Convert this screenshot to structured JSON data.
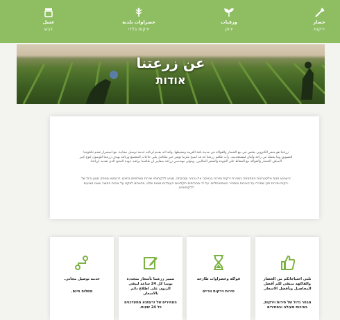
{
  "nav": [
    {
      "line1": "خضار",
      "line2": "ירקות",
      "icon": "carrot-icon"
    },
    {
      "line1": "ورقيات",
      "line2": "ירוק",
      "icon": "sprout-icon"
    },
    {
      "line1": "خضراوات بلدية",
      "line2": "ירקות בלדי",
      "icon": "plant-icon"
    },
    {
      "line1": "عسل",
      "line2": "דבש",
      "icon": "honey-jar-icon"
    }
  ],
  "hero": {
    "title": "عن زرعتنا",
    "subtitle": "אודות"
  },
  "about": {
    "p1": "زرعتنا هو متجر الكتروني يختص في بيع الخضار والفواكه في مدينة باقة الغربية ومحيطها, وكما انه يقدم لزبائنه خدمة توصيل مجانية. مع استمرار تقدم تكنلوجيا التسويق وما يحمله من راحة وأمان لمستخدميه, رأت طاقم زرعتنا انه قد اصبح ملزما توفير حيز متكامل يلبي حاجات المجتمع وزبائنه بهدف زرعتنا للوصول لنوع كبير لأصناف الخضار والفواكه مع الحفاظ على الجودة والسعر المثاليين. ويتولى مهندسي زراعة بمعايير ان طاقمنا يراقبة جودة المنتج الذي تقدمه لزبائننا.",
    "p2": "זרעתנא חנות אלקטרונית המתמחה במכירת ירקות ופירות בבאקה אל-גרביה וסביבתה, מציע ללקוחותיו שירות משלוחים בחינם. זרעתנא מספק מגוון גדול של ירקות ופירות תוך שמירה על האיכות והמחיר האופטימליים. על ידי מהנדסים חקלאיים העובדים בצוות שלנו, מחויבים לפקח על איכות המוצר שאנו מציעים ללקוחותינו."
  },
  "features": [
    {
      "icon": "thumbs-up-icon",
      "t1": "نلبي احتياجاتكم من الخضار والفاكهة منتقى لكم أفضل المحاصيل وبأفضل الاسعار.",
      "t2": "",
      "t3": "מבחר גדול של פירות וירקות, באיכות מעולה ובמחירים"
    },
    {
      "icon": "hourglass-icon",
      "t1": "فواكه وخضراوات طازجة",
      "t2": "פירות וירקות טריים",
      "t3": ""
    },
    {
      "icon": "edit-icon",
      "t1": "تتميز زرعتنا بأسعار متجددة يوميا كل 24 ساعة ليبقى الزبون على اطلاع دائم بالاسعار.",
      "t2": "",
      "t3": "המחירים של זרעתנא מתעדכנים כל 24 שעות."
    },
    {
      "icon": "route-icon",
      "t1": "خدمة توصيل مجاني.",
      "t2": "משלוח חינם.",
      "t3": ""
    }
  ]
}
